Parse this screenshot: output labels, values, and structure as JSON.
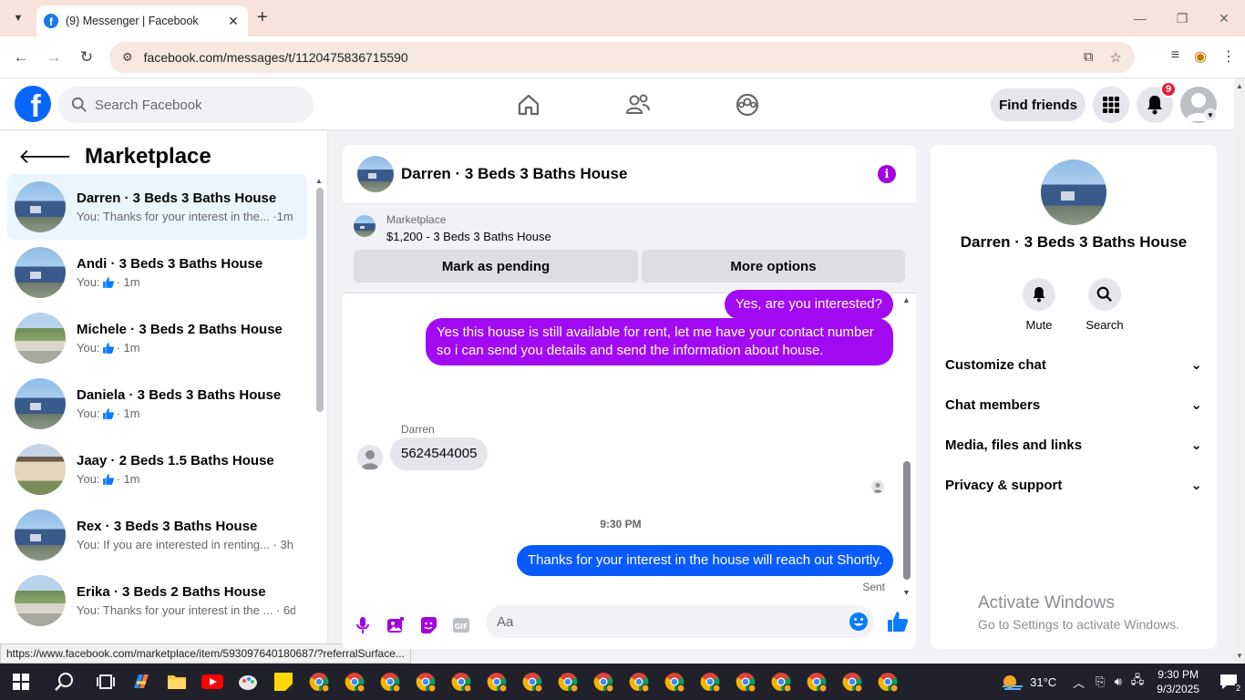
{
  "browser": {
    "tab_title": "(9) Messenger | Facebook",
    "url": "facebook.com/messages/t/1120475836715590",
    "status_url": "https://www.facebook.com/marketplace/item/593097640180687/?referralSurface..."
  },
  "fb_header": {
    "search_placeholder": "Search Facebook",
    "find_friends_label": "Find friends",
    "notification_count": "9"
  },
  "left_panel": {
    "title": "Marketplace",
    "chats": [
      {
        "name": "Darren · 3 Beds 3 Baths House",
        "snippet": "You: Thanks for your interest in the... ·1m",
        "active": true,
        "house": "blue"
      },
      {
        "name": "Andi · 3 Beds 3 Baths House",
        "snippet_prefix": "You:",
        "snippet_suffix": "· 1m",
        "house": "blue"
      },
      {
        "name": "Michele · 3 Beds 2 Baths House",
        "snippet_prefix": "You:",
        "snippet_suffix": "· 1m",
        "house": "tree"
      },
      {
        "name": "Daniela · 3 Beds 3 Baths House",
        "snippet_prefix": "You:",
        "snippet_suffix": "· 1m",
        "house": "blue"
      },
      {
        "name": "Jaay · 2 Beds 1.5 Baths House",
        "snippet_prefix": "You:",
        "snippet_suffix": "· 1m",
        "house": "beige"
      },
      {
        "name": "Rex · 3 Beds 3 Baths House",
        "snippet": "You: If you are interested in renting... · 3h",
        "house": "blue"
      },
      {
        "name": "Erika · 3 Beds 2 Baths House",
        "snippet": "You: Thanks for your interest in the ... · 6d",
        "house": "tree"
      }
    ]
  },
  "conversation": {
    "title": "Darren · 3 Beds 3 Baths House",
    "marketplace_label": "Marketplace",
    "listing": "$1,200 - 3 Beds 3 Baths House",
    "mark_pending_label": "Mark as pending",
    "more_options_label": "More options",
    "messages": {
      "m1": "Yes, are you interested?",
      "m2": "Yes this house is still available for rent, let me have your contact number so i can send you details and send the information about house.",
      "sender_name": "Darren",
      "m3": "5624544005",
      "timestamp": "9:30 PM",
      "m4": "Thanks for your interest in the house will reach out Shortly.",
      "sent_label": "Sent"
    },
    "composer_placeholder": "Aa"
  },
  "info_panel": {
    "name": "Darren · 3 Beds 3 Baths House",
    "mute_label": "Mute",
    "search_label": "Search",
    "sections": [
      "Customize chat",
      "Chat members",
      "Media, files and links",
      "Privacy & support"
    ]
  },
  "watermark": {
    "line1": "Activate Windows",
    "line2": "Go to Settings to activate Windows."
  },
  "taskbar": {
    "weather": "31°C",
    "time": "9:30 PM",
    "date": "9/3/2025",
    "notif_count": "2"
  },
  "colors": {
    "fb_blue": "#0866ff",
    "purple_bubble": "#a20bf2",
    "blue_bubble": "#0a5bff",
    "active_chat": "#ebf5ff"
  }
}
